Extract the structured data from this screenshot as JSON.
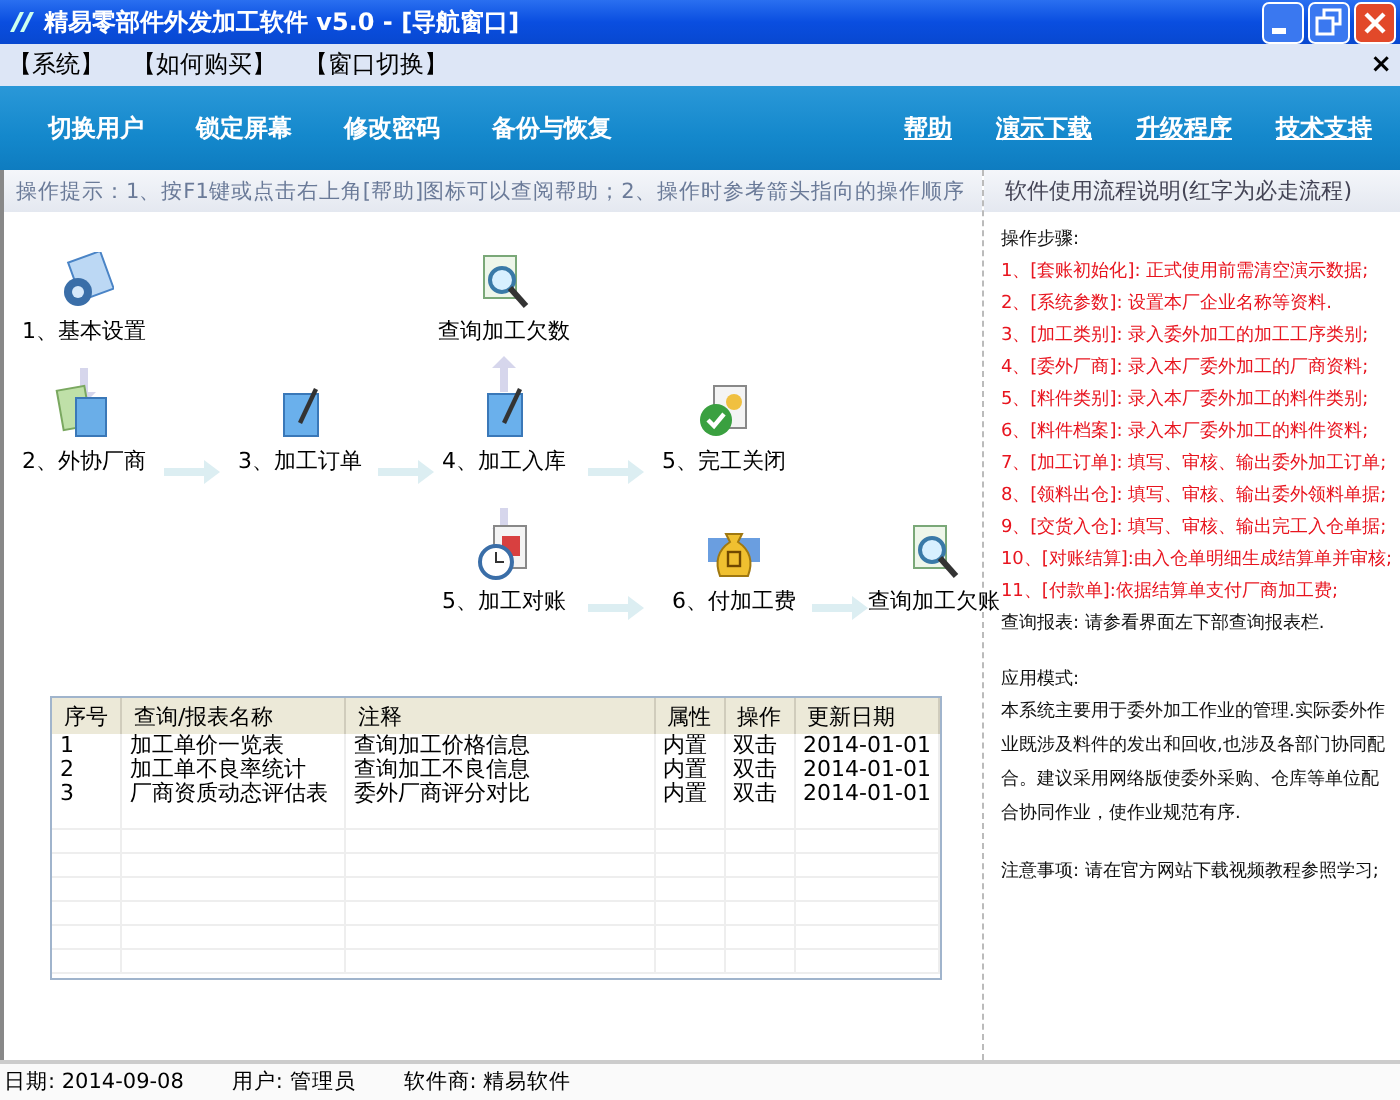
{
  "window": {
    "title": "精易零部件外发加工软件 v5.0 - [导航窗口]"
  },
  "menu": [
    "【系统】",
    "【如何购买】",
    "【窗口切换】"
  ],
  "menu_close": "×",
  "toolbar": {
    "left": [
      "切换用户",
      "锁定屏幕",
      "修改密码",
      "备份与恢复"
    ],
    "right": [
      "帮助",
      "演示下载",
      "升级程序",
      "技术支持"
    ]
  },
  "tip": "操作提示：1、按F1键或点击右上角[帮助]图标可以查阅帮助；2、操作时参考箭头指向的操作顺序",
  "flow": [
    {
      "label": "1、基本设置"
    },
    {
      "label": "查询加工欠数"
    },
    {
      "label": "2、外协厂商"
    },
    {
      "label": "3、加工订单"
    },
    {
      "label": "4、加工入库"
    },
    {
      "label": "5、完工关闭"
    },
    {
      "label": "5、加工对账"
    },
    {
      "label": "6、付加工费"
    },
    {
      "label": "查询加工欠账"
    }
  ],
  "table": {
    "columns": [
      "序号",
      "查询/报表名称",
      "注释",
      "属性",
      "操作",
      "更新日期"
    ],
    "rows": [
      [
        "1",
        "加工单价一览表",
        "查询加工价格信息",
        "内置",
        "双击",
        "2014-01-01"
      ],
      [
        "2",
        "加工单不良率统计",
        "查询加工不良信息",
        "内置",
        "双击",
        "2014-01-01"
      ],
      [
        "3",
        "厂商资质动态评估表",
        "委外厂商评分对比",
        "内置",
        "双击",
        "2014-01-01"
      ]
    ]
  },
  "panel": {
    "title": "软件使用流程说明(红字为必走流程)",
    "lines": [
      {
        "text": "操作步骤:",
        "required": false
      },
      {
        "text": "1、[套账初始化]: 正式使用前需清空演示数据;",
        "required": true
      },
      {
        "text": "2、[系统参数]: 设置本厂企业名称等资料.",
        "required": true
      },
      {
        "text": "3、[加工类别]: 录入委外加工的加工工序类别;",
        "required": true
      },
      {
        "text": "4、[委外厂商]: 录入本厂委外加工的厂商资料;",
        "required": true
      },
      {
        "text": "5、[料件类别]: 录入本厂委外加工的料件类别;",
        "required": true
      },
      {
        "text": "6、[料件档案]: 录入本厂委外加工的料件资料;",
        "required": true
      },
      {
        "text": "7、[加工订单]: 填写、审核、输出委外加工订单;",
        "required": true
      },
      {
        "text": "8、[领料出仓]: 填写、审核、输出委外领料单据;",
        "required": true
      },
      {
        "text": "9、[交货入仓]: 填写、审核、输出完工入仓单据;",
        "required": true
      },
      {
        "text": "10、[对账结算]:由入仓单明细生成结算单并审核;",
        "required": true
      },
      {
        "text": "11、[付款单]:依据结算单支付厂商加工费;",
        "required": true
      },
      {
        "text": "查询报表: 请参看界面左下部查询报表栏.",
        "required": false
      }
    ],
    "mode_title": "应用模式:",
    "mode_text": "本系统主要用于委外加工作业的管理.实际委外作业既涉及料件的发出和回收,也涉及各部门协同配合。建议采用网络版使委外采购、仓库等单位配合协同作业，使作业规范有序.",
    "note": "注意事项: 请在官方网站下载视频教程参照学习;"
  },
  "status": [
    "日期: 2014-09-08",
    "用户: 管理员",
    "软件商: 精易软件"
  ]
}
